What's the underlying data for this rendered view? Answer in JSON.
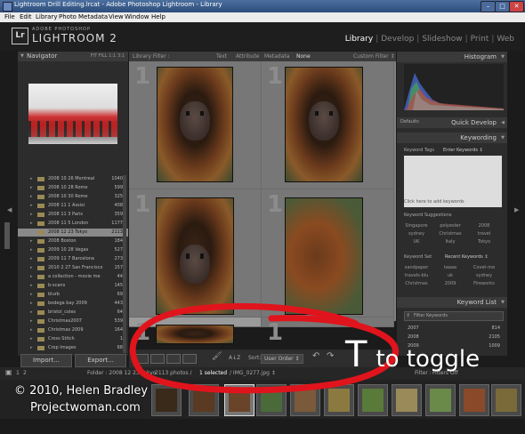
{
  "window": {
    "title": "Lightroom Drill Editing.lrcat - Adobe Photoshop Lightroom - Library",
    "buttons": [
      "–",
      "□",
      "✕"
    ]
  },
  "menu": [
    "File",
    "Edit",
    "Library",
    "Photo",
    "Metadata",
    "View",
    "Window",
    "Help"
  ],
  "identity": {
    "logo": "Lr",
    "adobe": "ADOBE PHOTOSHOP",
    "product": "LIGHTROOM 2"
  },
  "modules": {
    "items": [
      "Library",
      "Develop",
      "Slideshow",
      "Print",
      "Web"
    ],
    "active": "Library",
    "separator": "|"
  },
  "navigator": {
    "label": "Navigator",
    "options": "FIT  FILL  1:1  3:1"
  },
  "folders": [
    {
      "name": "2008 10 26 Montreal",
      "count": "1040"
    },
    {
      "name": "2008 10 28 Rome",
      "count": "599"
    },
    {
      "name": "2008 10 30 Rome",
      "count": "325"
    },
    {
      "name": "2008 11 1 Assisi",
      "count": "408"
    },
    {
      "name": "2008 11 3 Paris",
      "count": "359"
    },
    {
      "name": "2008 11 5 London",
      "count": "1177"
    },
    {
      "name": "2008 12 23 Tokyo",
      "count": "2113",
      "selected": true
    },
    {
      "name": "2008 Boston",
      "count": "184"
    },
    {
      "name": "2009 10 28 Vegas",
      "count": "527"
    },
    {
      "name": "2009 11 7 Barcelona",
      "count": "273"
    },
    {
      "name": "2010 2 27 San Francisco",
      "count": "157"
    },
    {
      "name": "a collection - movie me",
      "count": "44"
    },
    {
      "name": "b-scans",
      "count": "145"
    },
    {
      "name": "blurb",
      "count": "69"
    },
    {
      "name": "bodega bay 2009",
      "count": "443"
    },
    {
      "name": "bristol_coles",
      "count": "64"
    },
    {
      "name": "Christmas2007",
      "count": "539"
    },
    {
      "name": "Christmas 2009",
      "count": "164"
    },
    {
      "name": "Cross Stitch",
      "count": "1"
    },
    {
      "name": "Crop Images",
      "count": "68"
    }
  ],
  "leftbuttons": {
    "import": "Import...",
    "export": "Export..."
  },
  "filterbar": {
    "title": "Library Filter :",
    "text": "Text",
    "attribute": "Attribute",
    "metadata": "Metadata",
    "none": "None",
    "custom": "Custom Filter ↕"
  },
  "grid": [
    {
      "num": "1"
    },
    {
      "num": "1"
    },
    {
      "num": "1"
    },
    {
      "num": "1"
    },
    {
      "num": "1"
    },
    {
      "num": "1"
    }
  ],
  "toolbar": {
    "sort_label": "Sort:",
    "sort_value": "User Order ↕",
    "az": "A↓Z",
    "thumbnails": "Thumbnails"
  },
  "rightpanel": {
    "histogram": "Histogram",
    "quickdevelop": "Quick Develop",
    "saved_preset": "Defaults",
    "keywording": "Keywording",
    "keyword_tags": "Keyword Tags",
    "enter_keywords": "Enter Keywords ↕",
    "click_here": "Click here to add keywords",
    "keyword_suggestions": "Keyword Suggestions",
    "suggestions": [
      "Singapore",
      "polyester",
      "2008",
      "sydney",
      "Christmas",
      "travel",
      "UK",
      "Italy",
      "Tokyo"
    ],
    "keyword_set": "Keyword Set",
    "recent_keywords": "Recent Keywords ↕",
    "recent": [
      "sandpaper",
      "taaaa",
      "Covet-me",
      "travels-blu",
      "uk",
      "sydney",
      "Christmas",
      "2009",
      "Fireworks"
    ],
    "keyword_list": "Keyword List",
    "filter_keywords": "Filter Keywords",
    "list": [
      {
        "name": "2007",
        "count": "814"
      },
      {
        "name": "2008",
        "count": "2105"
      },
      {
        "name": "2009",
        "count": "1009"
      }
    ]
  },
  "filmstrip": {
    "page1": "1",
    "page2": "2",
    "folder": "Folder : 2008 12 23 Tokyo",
    "count": "2113 photos /",
    "selected": "1 selected",
    "file": "/ IMG_0277.jpg ↕",
    "filter_label": "Filter :",
    "filter_value": "Filters Off"
  },
  "annotation": {
    "letter": "T",
    "text": "to toggle",
    "copyright": "© 2010, Helen Bradley",
    "site": "Projectwoman.com",
    "loop_color": "#e0141c"
  }
}
